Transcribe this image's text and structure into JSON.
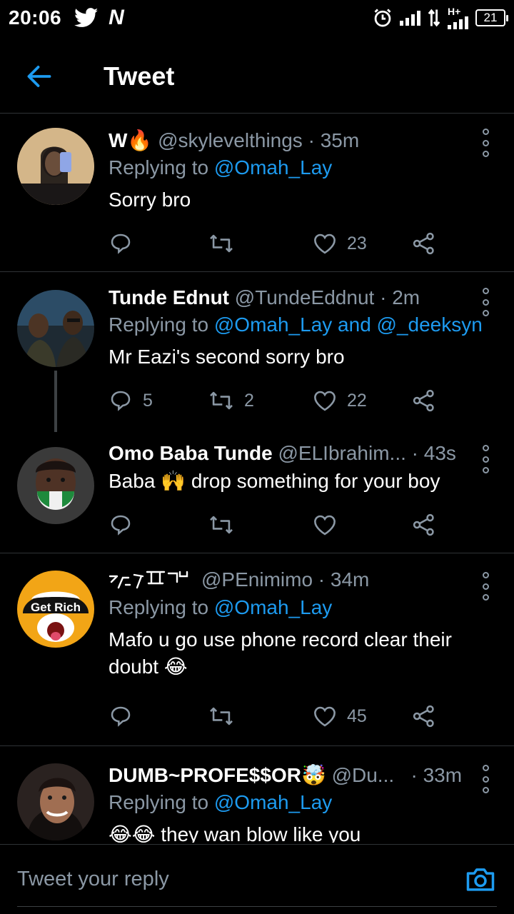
{
  "status_bar": {
    "time": "20:06",
    "battery": "21",
    "network": "H+"
  },
  "header": {
    "title": "Tweet"
  },
  "tweets": [
    {
      "name": "W🔥",
      "handle": "@skylevelthings",
      "time": "· 35m",
      "replying_prefix": "Replying to ",
      "replying_to": "@Omah_Lay",
      "text": "Sorry bro",
      "replies": "",
      "retweets": "",
      "likes": "23"
    },
    {
      "name": "Tunde Ednut",
      "handle": "@TundeEddnut",
      "time": "· 2m",
      "replying_prefix": "Replying to ",
      "replying_to": "@Omah_Lay and @_deeksyn",
      "text": "Mr Eazi's second sorry bro",
      "replies": "5",
      "retweets": "2",
      "likes": "22"
    },
    {
      "name": "Omo Baba Tunde",
      "handle": "@ELIbrahim...",
      "time": "· 43s",
      "text": "Baba 🙌 drop something for your boy",
      "replies": "",
      "retweets": "",
      "likes": ""
    },
    {
      "name": "",
      "handle": "@PEnimimo",
      "time": "· 34m",
      "replying_prefix": "Replying to ",
      "replying_to": "@Omah_Lay",
      "text": "Mafo u go use phone record clear their doubt 😂",
      "avatar_label": "Get Rich",
      "replies": "",
      "retweets": "",
      "likes": "45"
    },
    {
      "name": "DUMB~PROFE$$OR🤯",
      "handle": "@Du...",
      "time": "· 33m",
      "replying_prefix": "Replying to ",
      "replying_to": "@Omah_Lay",
      "text": "😂😂 they wan blow like you"
    }
  ],
  "reply_bar": {
    "placeholder": "Tweet your reply"
  },
  "colors": {
    "accent": "#1d9bf0",
    "muted": "#8b98a5",
    "divider": "#2f3336",
    "background": "#000000"
  }
}
